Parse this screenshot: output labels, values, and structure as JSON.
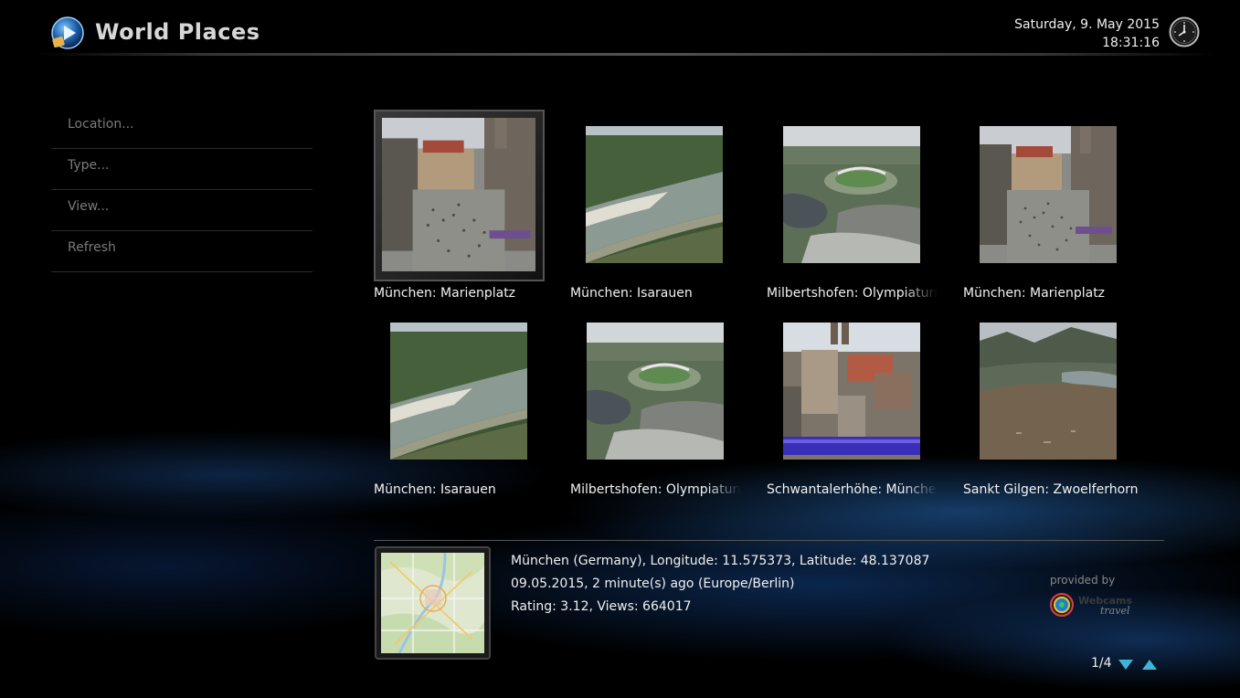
{
  "header": {
    "title": "World Places",
    "date": "Saturday, 9. May 2015",
    "time": "18:31:16",
    "logo_icon": "media-center-logo-icon",
    "clock_icon": "clock-icon"
  },
  "menu": {
    "items": [
      {
        "label": "Location..."
      },
      {
        "label": "Type..."
      },
      {
        "label": "View..."
      },
      {
        "label": "Refresh"
      }
    ]
  },
  "places": [
    {
      "caption": "München: Marienplatz",
      "scene": "plaza",
      "selected": true
    },
    {
      "caption": "München: Isarauen",
      "scene": "river"
    },
    {
      "caption": "Milbertshofen: Olympiaturm",
      "scene": "olympic"
    },
    {
      "caption": "München: Marienplatz",
      "scene": "plaza"
    },
    {
      "caption": "München: Isarauen",
      "scene": "river"
    },
    {
      "caption": "Milbertshofen: Olympiaturm",
      "scene": "olympic"
    },
    {
      "caption": "Schwantalerhöhe: München",
      "scene": "city"
    },
    {
      "caption": "Sankt Gilgen: Zwoelferhorn",
      "scene": "mountain"
    }
  ],
  "details": {
    "line1": "München (Germany), Longitude: 11.575373, Latitude: 48.137087",
    "line2": "09.05.2015, 2 minute(s) ago (Europe/Berlin)",
    "line3": "Rating: 3.12, Views: 664017",
    "map_icon": "location-map-thumbnail"
  },
  "provider": {
    "label": "provided by",
    "name": "Webcams",
    "sub": "travel"
  },
  "pager": {
    "text": "1/4",
    "down_icon": "arrow-down-icon",
    "up_icon": "arrow-up-icon"
  },
  "colors": {
    "accent": "#3fb4d8",
    "menu_text": "#7a7a7a",
    "text": "#f0f0f0"
  }
}
